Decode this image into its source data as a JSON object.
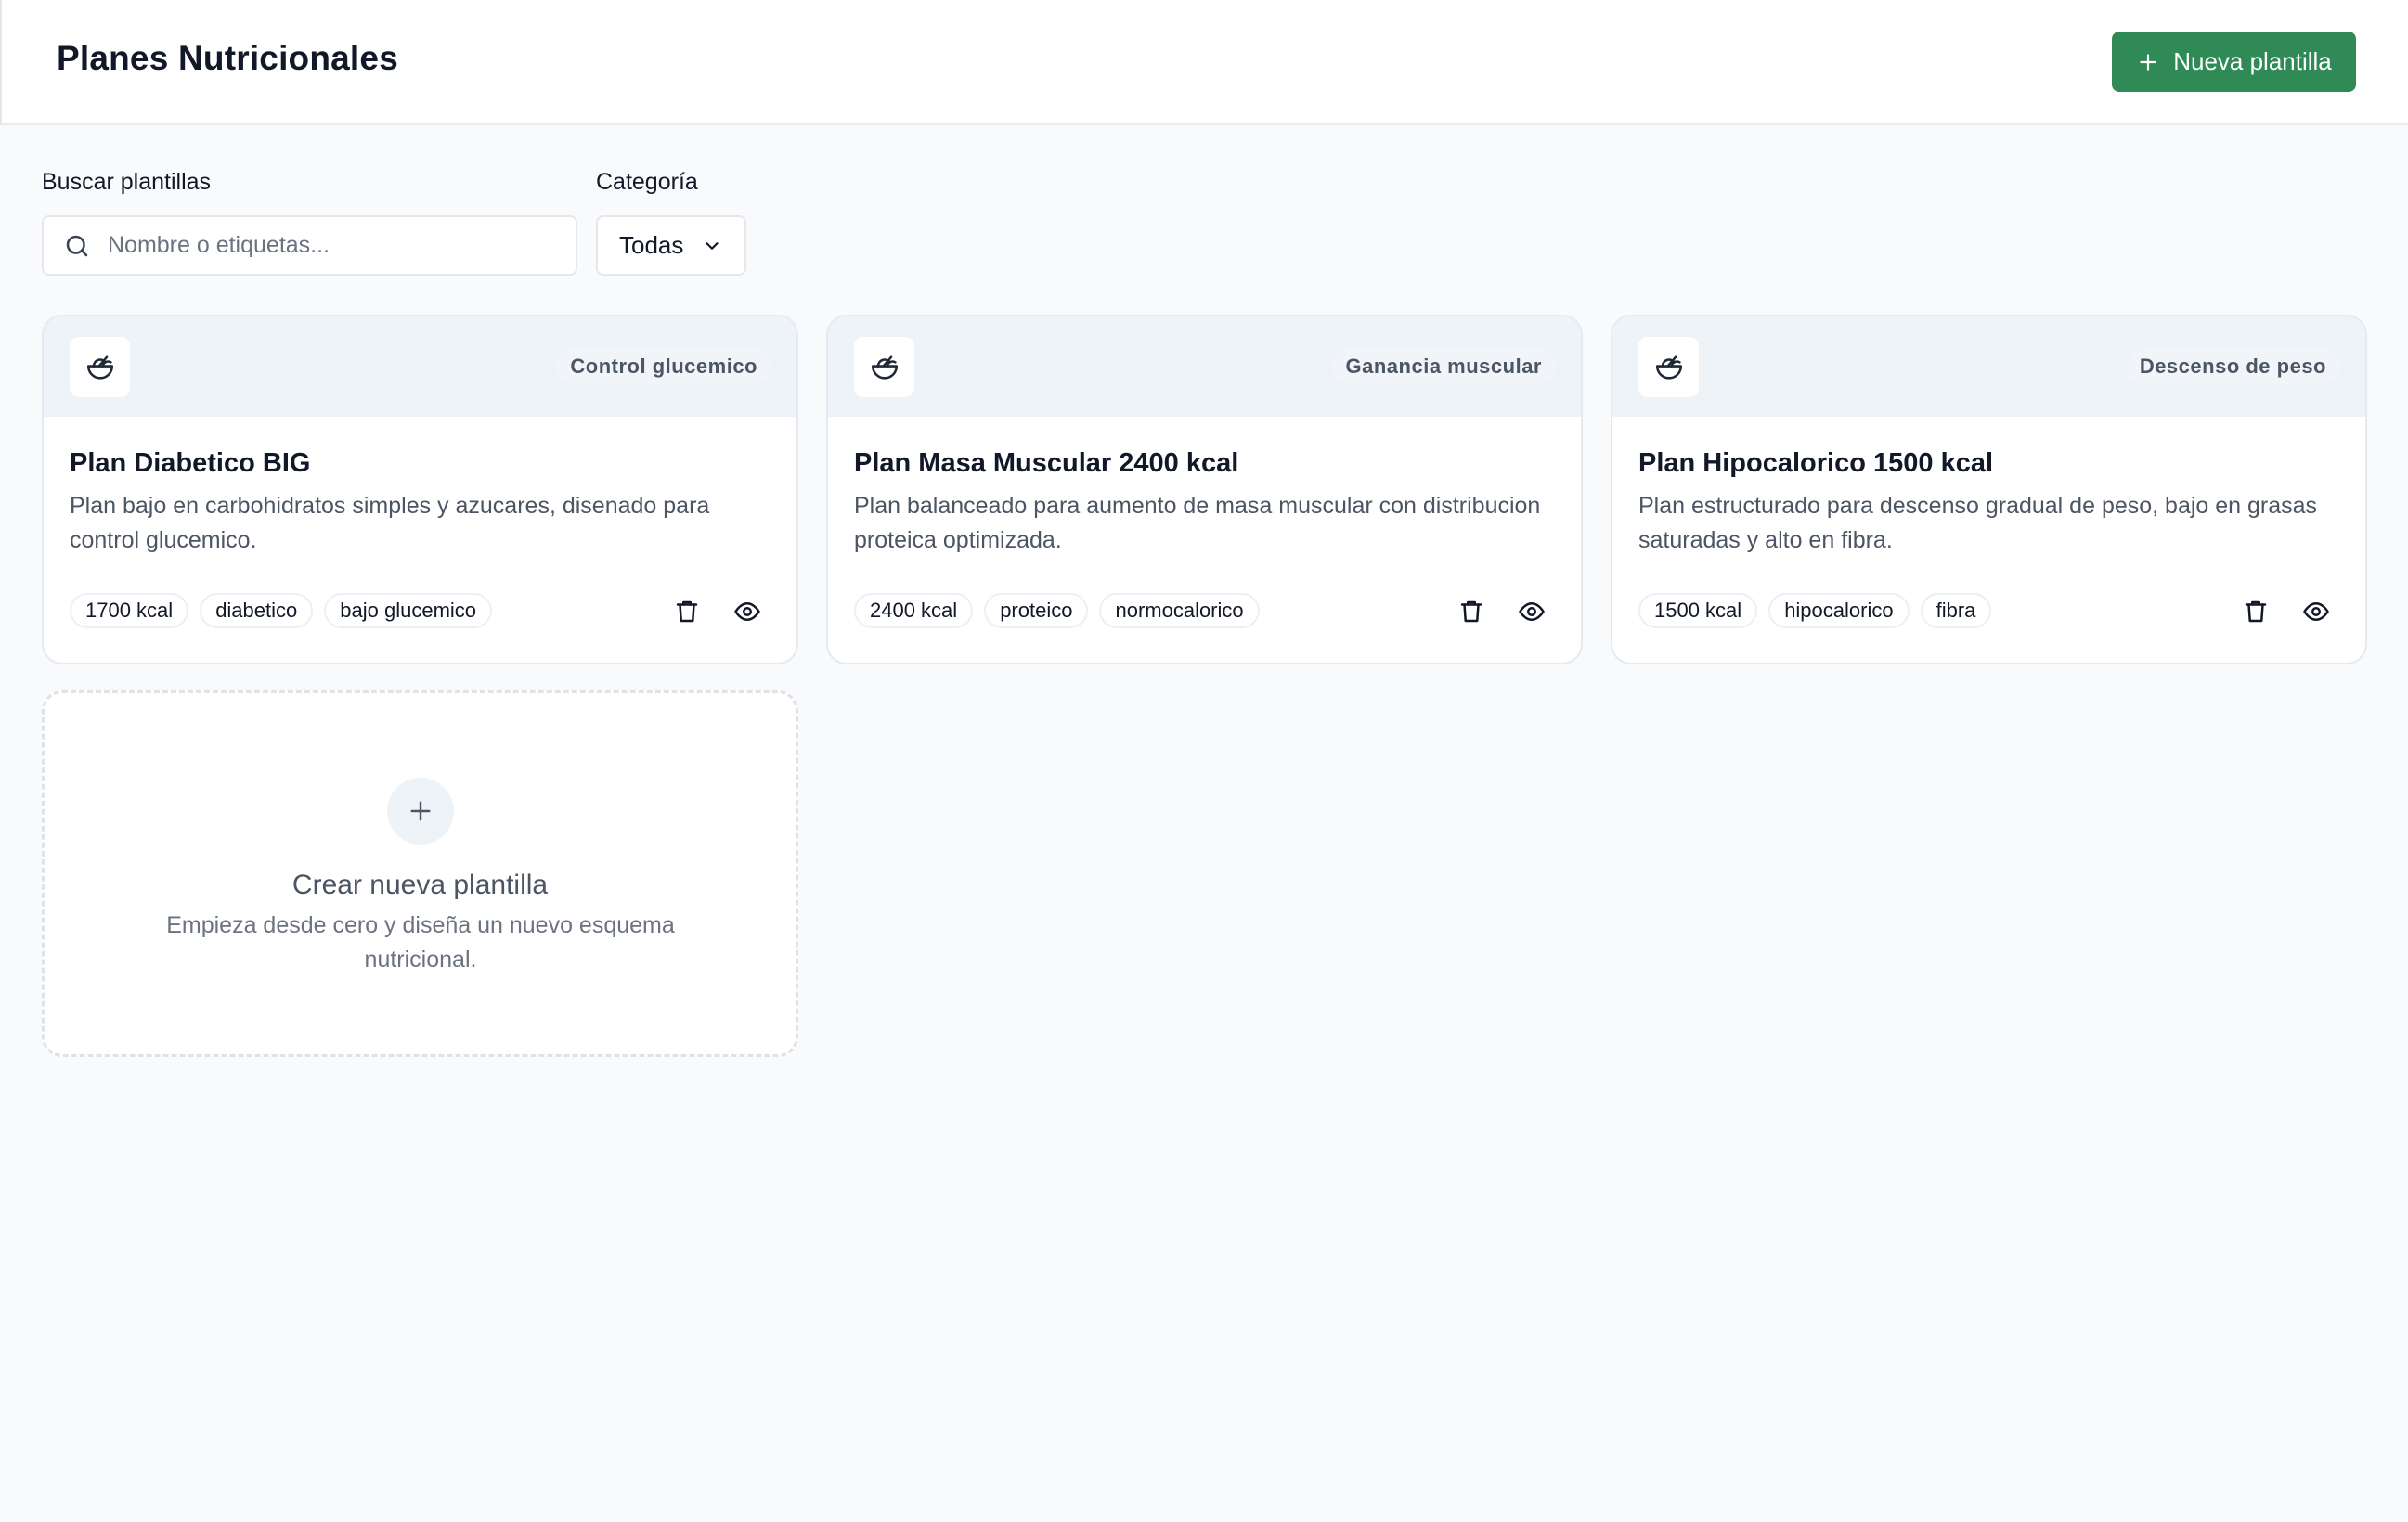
{
  "header": {
    "title": "Planes Nutricionales",
    "new_button_label": "Nueva plantilla"
  },
  "filters": {
    "search_label": "Buscar plantillas",
    "search_placeholder": "Nombre o etiquetas...",
    "category_label": "Categoría",
    "category_value": "Todas"
  },
  "cards": [
    {
      "category": "Control glucemico",
      "title": "Plan Diabetico BIG",
      "description": "Plan bajo en carbohidratos simples y azucares, disenado para control glucemico.",
      "tags": [
        "1700 kcal",
        "diabetico",
        "bajo glucemico"
      ]
    },
    {
      "category": "Ganancia muscular",
      "title": "Plan Masa Muscular 2400 kcal",
      "description": "Plan balanceado para aumento de masa muscular con distribucion proteica optimizada.",
      "tags": [
        "2400 kcal",
        "proteico",
        "normocalorico"
      ]
    },
    {
      "category": "Descenso de peso",
      "title": "Plan Hipocalorico 1500 kcal",
      "description": "Plan estructurado para descenso gradual de peso, bajo en grasas saturadas y alto en fibra.",
      "tags": [
        "1500 kcal",
        "hipocalorico",
        "fibra"
      ]
    }
  ],
  "create_card": {
    "title": "Crear nueva plantilla",
    "description": "Empieza desde cero y diseña un nuevo esquema nutricional."
  },
  "colors": {
    "primary": "#2f8a55",
    "card_header_bg": "#eef3f8",
    "page_bg": "#f9fafb"
  },
  "icons": {
    "card_icon": "salad-bowl-icon",
    "delete": "trash-icon",
    "view": "eye-icon"
  }
}
